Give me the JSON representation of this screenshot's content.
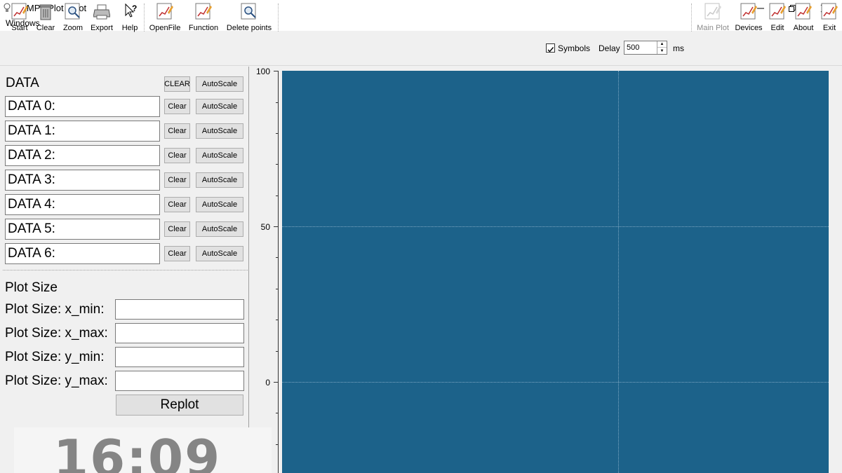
{
  "window": {
    "title": "LAMPh Plot - plot",
    "menu": [
      "Windows"
    ]
  },
  "toolbar": {
    "left_buttons": [
      {
        "label": "Start",
        "icon": "chart-pencil-icon"
      },
      {
        "label": "Clear",
        "icon": "trash-can-icon"
      },
      {
        "label": "Zoom",
        "icon": "zoom-magnifier-icon"
      },
      {
        "label": "Export",
        "icon": "printer-icon"
      },
      {
        "label": "Help",
        "icon": "help-cursor-icon"
      },
      {
        "label": "OpenFile",
        "icon": "chart-pencil-icon"
      },
      {
        "label": "Function",
        "icon": "chart-pencil-icon"
      },
      {
        "label": "Delete points",
        "icon": "zoom-magnifier-icon"
      }
    ],
    "symbols": {
      "label": "Symbols",
      "checked": true
    },
    "delay": {
      "label": "Delay",
      "value": "500",
      "unit": "ms"
    },
    "right_buttons": [
      {
        "label": "Main Plot",
        "icon": "chart-pencil-icon",
        "disabled": true
      },
      {
        "label": "Devices",
        "icon": "chart-pencil-icon"
      },
      {
        "label": "Edit",
        "icon": "chart-pencil-icon"
      },
      {
        "label": "About",
        "icon": "chart-pencil-icon"
      },
      {
        "label": "Exit",
        "icon": "chart-pencil-icon"
      }
    ]
  },
  "data_panel": {
    "heading": "DATA",
    "clear_all_label": "CLEAR",
    "autoscale_all_label": "AutoScale",
    "row_clear_label": "Clear",
    "row_autoscale_label": "AutoScale",
    "rows": [
      "DATA 0:",
      "DATA 1:",
      "DATA 2:",
      "DATA 3:",
      "DATA 4:",
      "DATA 5:",
      "DATA 6:"
    ]
  },
  "plot_size": {
    "heading": "Plot Size",
    "fields": [
      {
        "label": "Plot Size: x_min:",
        "value": ""
      },
      {
        "label": "Plot Size: x_max:",
        "value": ""
      },
      {
        "label": "Plot Size: y_min:",
        "value": ""
      },
      {
        "label": "Plot Size: y_max:",
        "value": ""
      }
    ],
    "replot_label": "Replot"
  },
  "clock": {
    "time": "16:09"
  },
  "plot": {
    "background_color": "#1c628a",
    "y_ticks": [
      "100",
      "50",
      "0"
    ],
    "grid": true
  },
  "colors": {
    "plot_background": "#1c628a",
    "grid_line": "#7fa8c4",
    "window_background": "#f0f0f0"
  }
}
